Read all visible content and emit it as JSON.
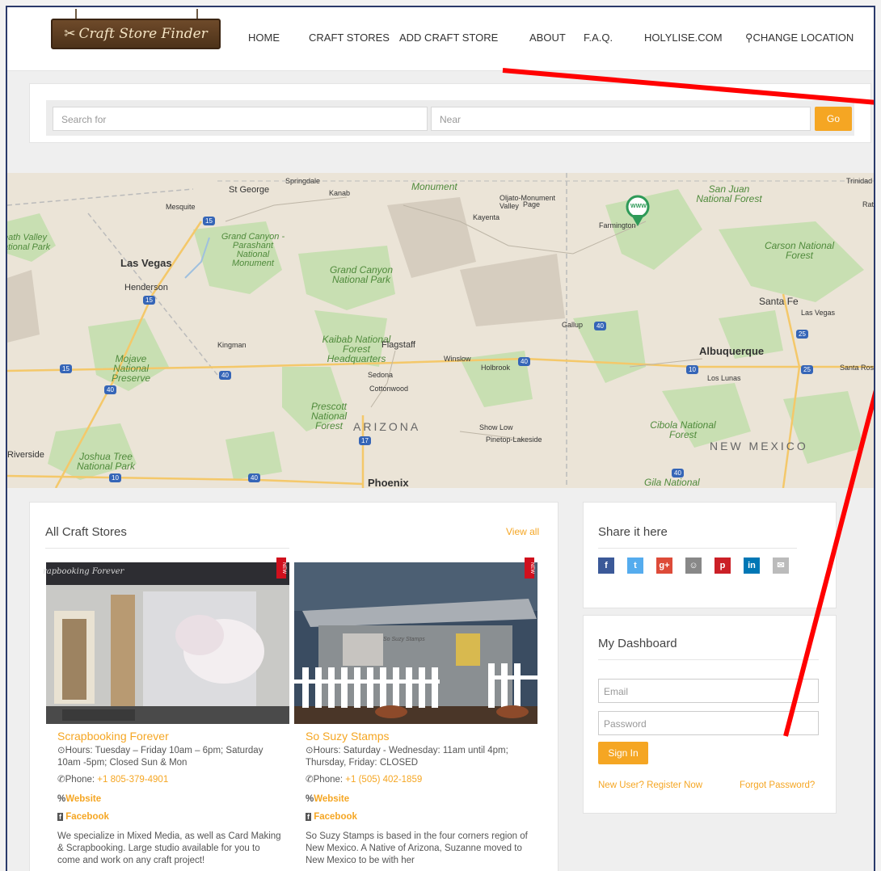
{
  "logo": {
    "text": "Craft Store Finder"
  },
  "nav": {
    "items": [
      "HOME",
      "CRAFT STORES",
      "ADD CRAFT STORE",
      "ABOUT",
      "F.A.Q.",
      "HOLYLISE.COM",
      "CHANGE LOCATION"
    ]
  },
  "search": {
    "for_placeholder": "Search for",
    "near_placeholder": "Near",
    "go_label": "Go"
  },
  "map": {
    "labels": [
      "St George",
      "Springdale",
      "Kanab",
      "Monument",
      "Page",
      "Oljato-Monument Valley",
      "Kayenta",
      "San Juan National Forest",
      "Trinidad",
      "Raton",
      "Mesquite",
      "eath Valley ational Park",
      "Grand Canyon - Parashant National Monument",
      "Las Vegas",
      "Henderson",
      "Grand Canyon National Park",
      "Farmington",
      "Carson National Forest",
      "Santa Fe",
      "Las Vegas",
      "Gallup",
      "Kingman",
      "Kaibab National Forest Headquarters",
      "Flagstaff",
      "Winslow",
      "Holbrook",
      "Albuquerque",
      "Los Lunas",
      "Santa Rosa",
      "Sedona",
      "Cottonwood",
      "Mojave National Preserve",
      "Prescott National Forest",
      "ARIZONA",
      "Show Low",
      "Pinetop-Lakeside",
      "Cibola National Forest",
      "NEW MEXICO",
      "Riverside",
      "Joshua Tree National Park",
      "Phoenix",
      "Gila National"
    ],
    "highways": [
      "15",
      "15",
      "40",
      "15",
      "40",
      "40",
      "40",
      "17",
      "10",
      "10",
      "40",
      "25",
      "40",
      "25",
      "National"
    ],
    "marker_label": "WWW"
  },
  "stores_card": {
    "title": "All Craft Stores",
    "view_all": "View all"
  },
  "stores": [
    {
      "image_sign": "rapbooking Forever",
      "name": "Scrapbooking Forever",
      "hours": "Hours: Tuesday – Friday 10am – 6pm; Saturday 10am -5pm; Closed Sun & Mon",
      "phone_label": "Phone: ",
      "phone": "+1 805-379-4901",
      "website": "Website",
      "facebook": "Facebook",
      "desc": "We specialize in Mixed Media, as well as Card Making & Scrapbooking. Large studio available for you to come and work on any craft project!",
      "badge": "NEW"
    },
    {
      "image_sign": "So Suzy Stamps",
      "name": "So Suzy Stamps",
      "hours": "Hours: Saturday - Wednesday: 11am until 4pm; Thursday, Friday: CLOSED",
      "phone_label": "Phone: ",
      "phone": "+1 (505) 402-1859",
      "website": "Website",
      "facebook": "Facebook",
      "desc": "So Suzy Stamps is based in the four corners region of New Mexico. A Native of Arizona, Suzanne moved to New Mexico to be with her",
      "badge": "NEW"
    }
  ],
  "share": {
    "title": "Share it here",
    "icons": [
      "facebook-icon",
      "twitter-icon",
      "google-plus-icon",
      "reddit-icon",
      "pinterest-icon",
      "linkedin-icon",
      "email-icon"
    ],
    "glyphs": [
      "f",
      "t",
      "g+",
      "☺",
      "p",
      "in",
      "✉"
    ],
    "colors": [
      "#3b5998",
      "#55acee",
      "#dd4b39",
      "#888888",
      "#cb2027",
      "#0077b5",
      "#bbbbbb"
    ]
  },
  "dashboard": {
    "title": "My Dashboard",
    "email_placeholder": "Email",
    "password_placeholder": "Password",
    "signin_label": "Sign In",
    "register_link": "New User? Register Now",
    "forgot_link": "Forgot Password?"
  },
  "colors": {
    "accent": "#f5a623",
    "annotation": "#ff0000"
  }
}
